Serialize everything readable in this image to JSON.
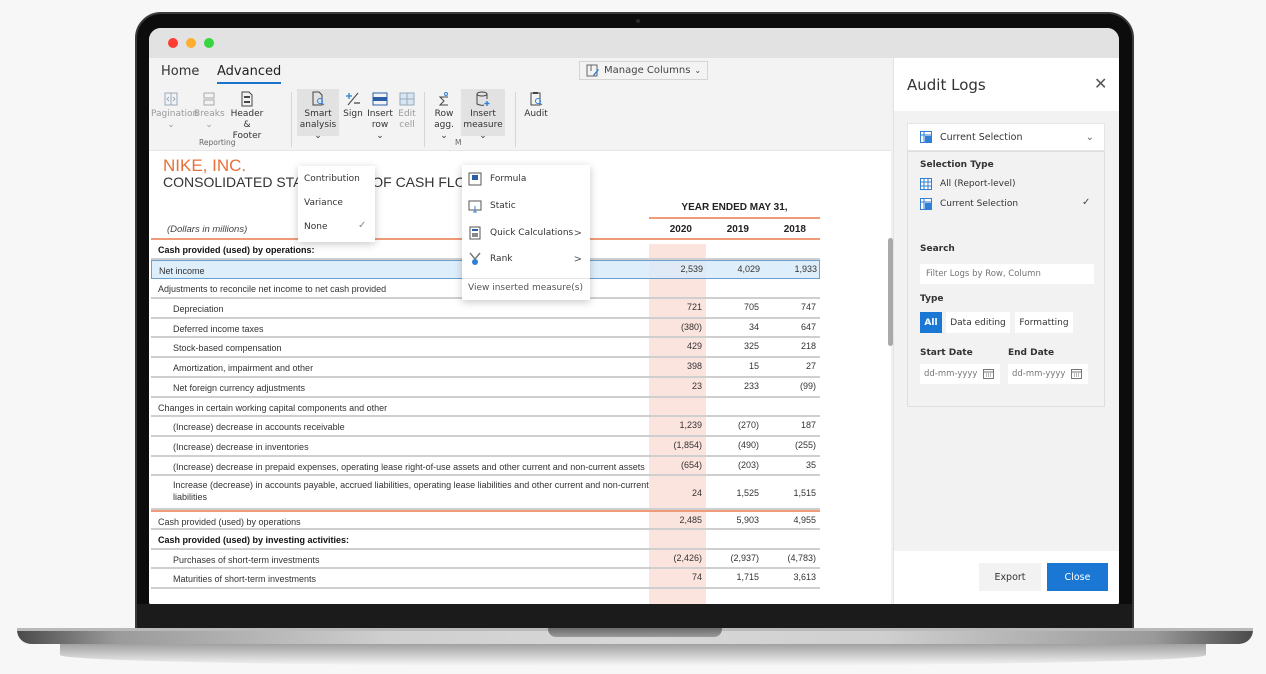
{
  "window": {
    "controls": [
      "close",
      "minimize",
      "maximize"
    ]
  },
  "ribbon": {
    "tabs": [
      {
        "label": "Home",
        "active": false
      },
      {
        "label": "Advanced",
        "active": true
      }
    ],
    "manage_columns": "Manage Columns",
    "tools": {
      "pagination": {
        "line1": "Pagination",
        "line2": "⌄",
        "enabled": false
      },
      "breaks": {
        "line1": "Breaks",
        "line2": "⌄",
        "enabled": false
      },
      "header_footer": {
        "line1": "Header",
        "line2": "& Footer",
        "enabled": true
      },
      "smart_analysis": {
        "line1": "Smart",
        "line2": "analysis ⌄",
        "enabled": true,
        "pressed": true
      },
      "sign": {
        "line1": "Sign",
        "line2": "",
        "enabled": true
      },
      "insert_row": {
        "line1": "Insert",
        "line2": "row ⌄",
        "enabled": true
      },
      "edit_cell": {
        "line1": "Edit",
        "line2": "cell",
        "enabled": false
      },
      "row_agg": {
        "line1": "Row",
        "line2": "agg. ⌄",
        "enabled": true
      },
      "insert_measure": {
        "line1": "Insert",
        "line2": "measure ⌄",
        "enabled": true,
        "pressed": true
      },
      "audit": {
        "line1": "Audit",
        "line2": "",
        "enabled": true
      }
    },
    "groups": {
      "reporting": "Reporting",
      "measures": "M"
    }
  },
  "smart_analysis_menu": {
    "items": [
      {
        "label": "Contribution",
        "checked": false
      },
      {
        "label": "Variance",
        "checked": false
      },
      {
        "label": "None",
        "checked": true
      }
    ],
    "check_glyph": "✓"
  },
  "insert_measure_menu": {
    "items": [
      {
        "label": "Formula",
        "icon": "formula-icon",
        "submenu": false
      },
      {
        "label": "Static",
        "icon": "static-icon",
        "submenu": false
      },
      {
        "label": "Quick Calculations",
        "icon": "calculator-icon",
        "submenu": true
      },
      {
        "label": "Rank",
        "icon": "rank-medal-icon",
        "submenu": true
      }
    ],
    "arrow": ">",
    "view_link": "View inserted measure(s)"
  },
  "report": {
    "company": "NIKE, INC.",
    "statement": "CONSOLIDATED STATEMENTS OF CASH FLOWS",
    "period_header": "YEAR ENDED MAY 31,",
    "units": "(Dollars in millions)",
    "columns": [
      "2020",
      "2019",
      "2018"
    ],
    "highlight_color": "#fbe3de",
    "rows": [
      {
        "label": "Cash provided (used) by operations:",
        "values": [
          "",
          "",
          ""
        ],
        "style": "bold",
        "indent": 0
      },
      {
        "label": "Net income",
        "values": [
          "2,539",
          "4,029",
          "1,933"
        ],
        "style": "selected",
        "indent": 0
      },
      {
        "label": "Adjustments to reconcile net income to net cash provided",
        "values": [
          "",
          "",
          ""
        ],
        "style": "normal",
        "indent": 0
      },
      {
        "label": "Depreciation",
        "values": [
          "721",
          "705",
          "747"
        ],
        "style": "normal",
        "indent": 1
      },
      {
        "label": "Deferred income taxes",
        "values": [
          "(380)",
          "34",
          "647"
        ],
        "style": "normal",
        "indent": 1
      },
      {
        "label": "Stock-based compensation",
        "values": [
          "429",
          "325",
          "218"
        ],
        "style": "normal",
        "indent": 1
      },
      {
        "label": "Amortization, impairment and other",
        "values": [
          "398",
          "15",
          "27"
        ],
        "style": "normal",
        "indent": 1
      },
      {
        "label": "Net foreign currency adjustments",
        "values": [
          "23",
          "233",
          "(99)"
        ],
        "style": "normal",
        "indent": 1
      },
      {
        "label": "Changes in certain working capital components and other",
        "values": [
          "",
          "",
          ""
        ],
        "style": "normal",
        "indent": 0
      },
      {
        "label": "(Increase) decrease in accounts receivable",
        "values": [
          "1,239",
          "(270)",
          "187"
        ],
        "style": "normal",
        "indent": 1
      },
      {
        "label": "(Increase) decrease in inventories",
        "values": [
          "(1,854)",
          "(490)",
          "(255)"
        ],
        "style": "normal",
        "indent": 1
      },
      {
        "label": "(Increase) decrease in prepaid expenses, operating lease right-of-use assets and other current and non-current assets",
        "values": [
          "(654)",
          "(203)",
          "35"
        ],
        "style": "normal",
        "indent": 1
      },
      {
        "label": "Increase (decrease) in accounts payable, accrued liabilities, operating lease liabilities and other current and non-current liabilities",
        "values": [
          "24",
          "1,525",
          "1,515"
        ],
        "style": "tall",
        "indent": 1
      },
      {
        "label": "Cash provided (used) by operations",
        "values": [
          "2,485",
          "5,903",
          "4,955"
        ],
        "style": "total",
        "indent": 0
      },
      {
        "label": "Cash provided (used) by investing activities:",
        "values": [
          "",
          "",
          ""
        ],
        "style": "bold",
        "indent": 0
      },
      {
        "label": "Purchases of short-term investments",
        "values": [
          "(2,426)",
          "(2,937)",
          "(4,783)"
        ],
        "style": "normal",
        "indent": 1
      },
      {
        "label": "Maturities of short-term investments",
        "values": [
          "74",
          "1,715",
          "3,613"
        ],
        "style": "normal",
        "indent": 1
      }
    ]
  },
  "audit_panel": {
    "title": "Audit Logs",
    "close_glyph": "✕",
    "selection_dropdown": {
      "value": "Current Selection",
      "chevron": "⌄"
    },
    "selection_type_label": "Selection Type",
    "selection_options": [
      {
        "label": "All (Report-level)",
        "checked": false
      },
      {
        "label": "Current Selection",
        "checked": true
      }
    ],
    "check_glyph": "✓",
    "search_label": "Search",
    "search_placeholder": "Filter Logs by Row, Column",
    "type_label": "Type",
    "type_buttons": [
      {
        "label": "All",
        "active": true
      },
      {
        "label": "Data editing",
        "active": false
      },
      {
        "label": "Formatting",
        "active": false
      }
    ],
    "start_date_label": "Start Date",
    "end_date_label": "End Date",
    "date_placeholder": "dd-mm-yyyy",
    "export_label": "Export",
    "close_label": "Close",
    "accent": "#1a78d4"
  }
}
